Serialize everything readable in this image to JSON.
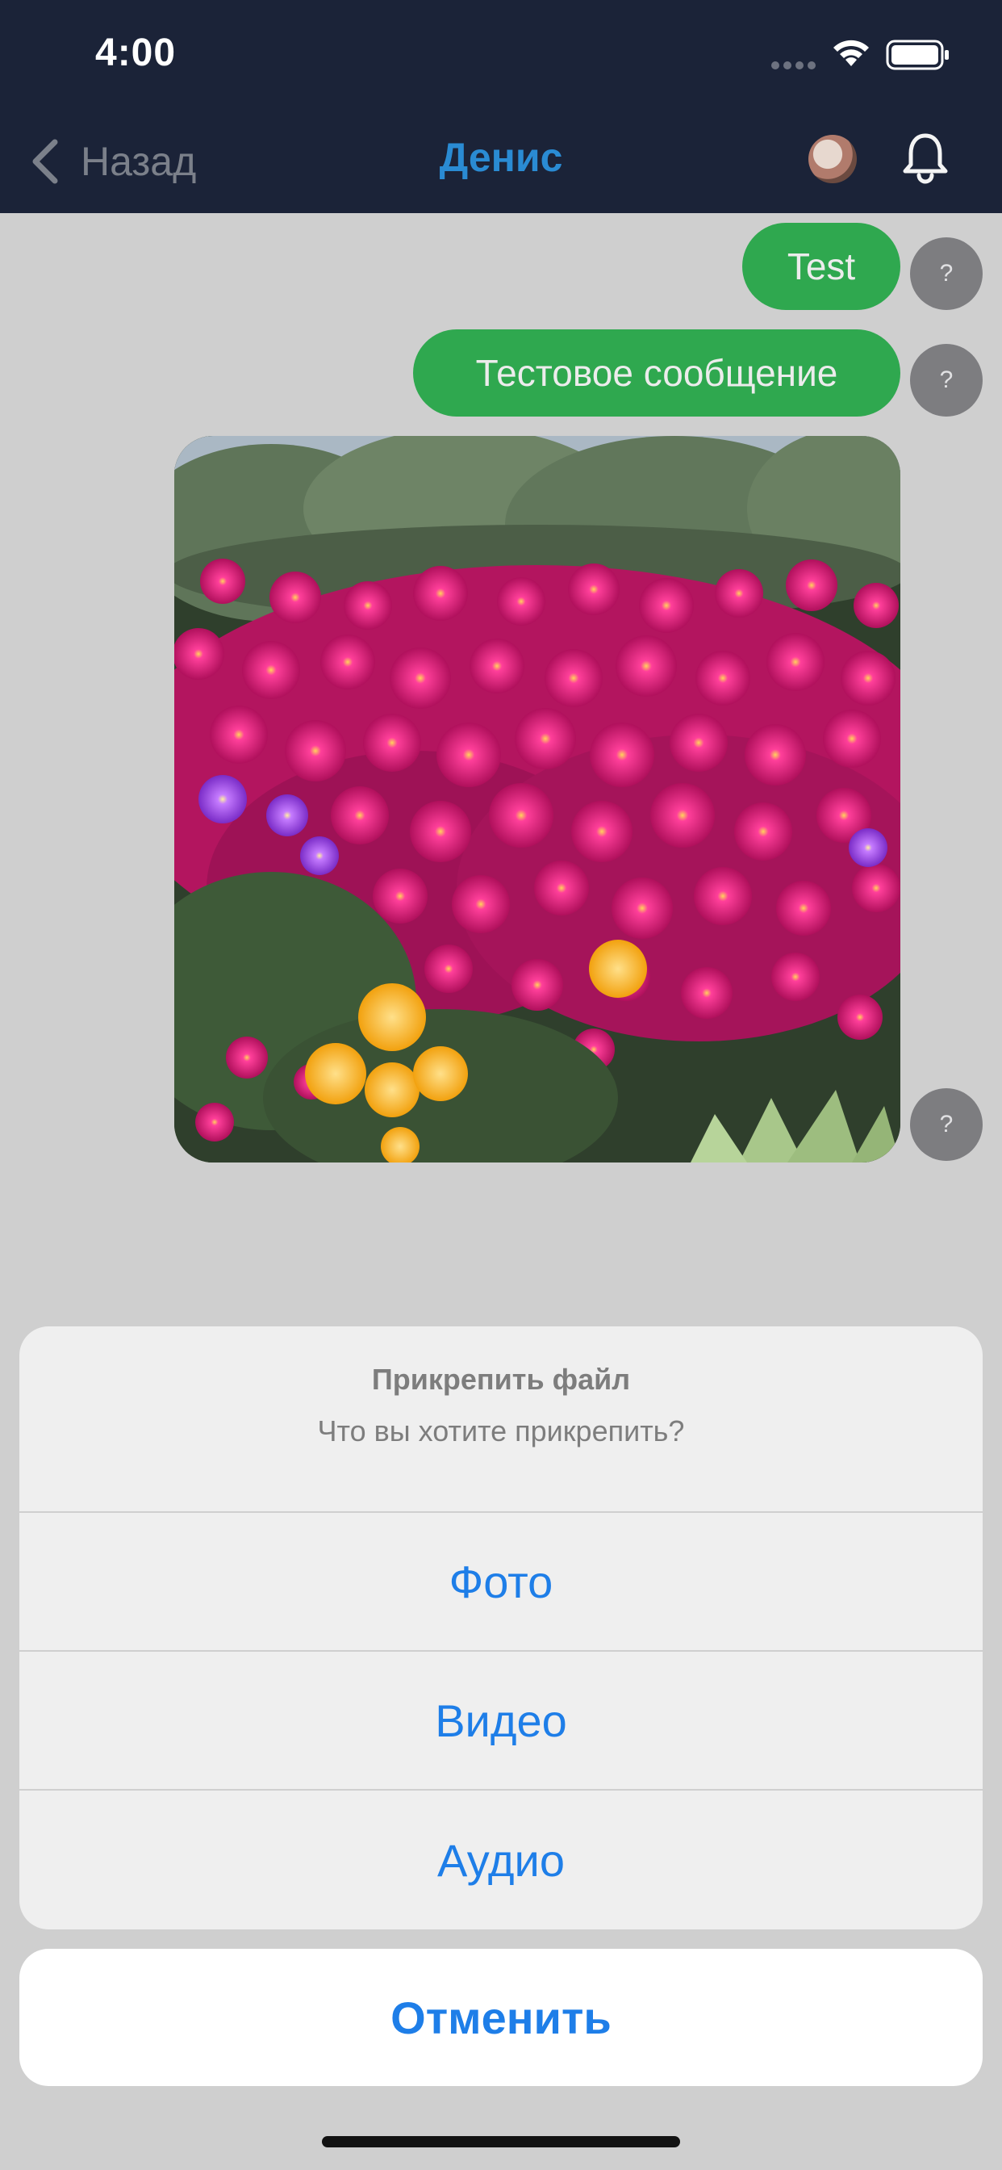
{
  "status_bar": {
    "time": "4:00"
  },
  "nav": {
    "back_label": "Назад",
    "title": "Денис"
  },
  "messages": [
    {
      "text": "Test",
      "status": "?"
    },
    {
      "text": "Тестовое сообщение",
      "status": "?"
    },
    {
      "type": "image",
      "status": "?"
    }
  ],
  "action_sheet": {
    "title": "Прикрепить файл",
    "message": "Что вы хотите прикрепить?",
    "options": [
      "Фото",
      "Видео",
      "Аудио"
    ],
    "cancel_label": "Отменить"
  },
  "colors": {
    "header_bg": "#1b2338",
    "title": "#2a8bd3",
    "outgoing_bubble": "#2fa84f",
    "action_blue": "#1e7ee8"
  }
}
